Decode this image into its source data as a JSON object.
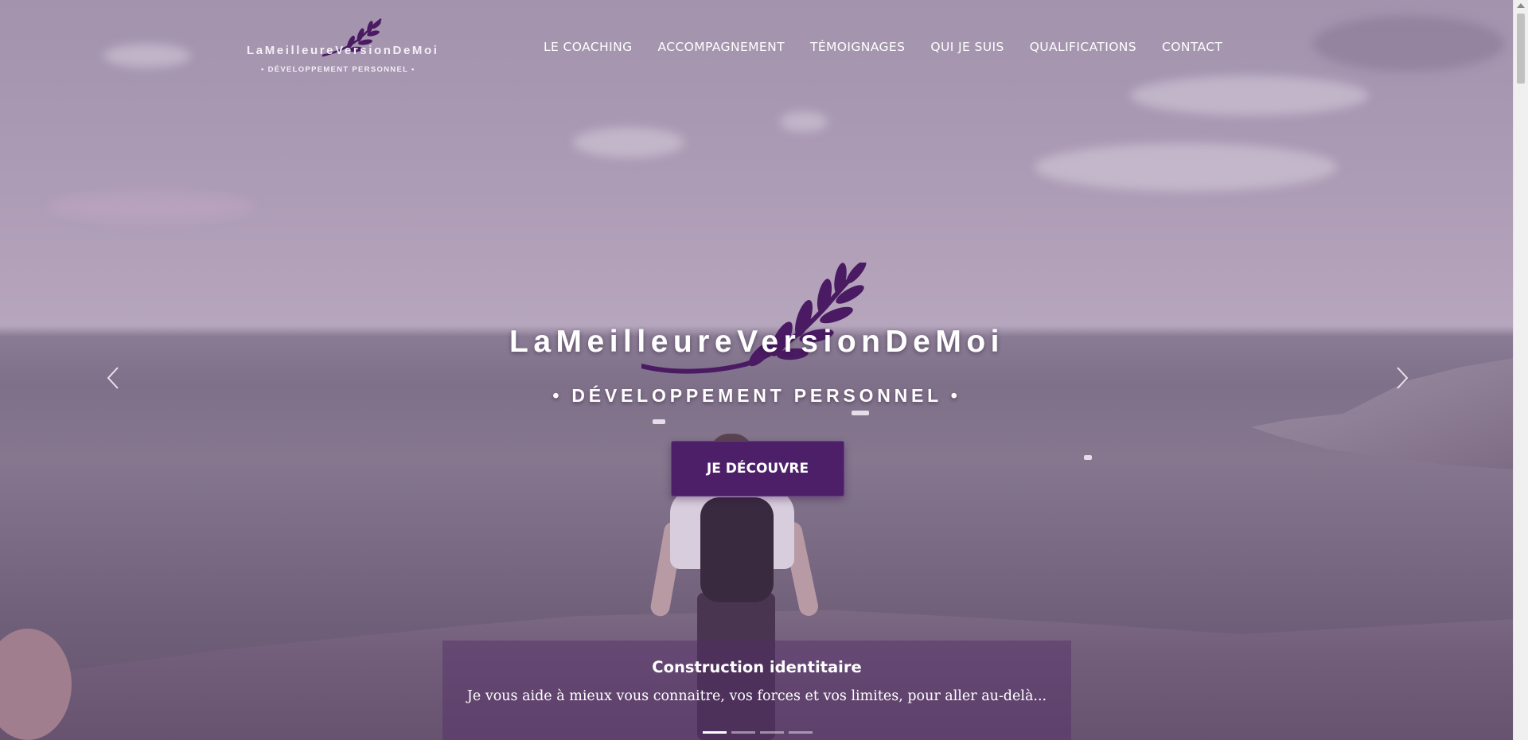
{
  "brand": {
    "name": "LaMeilleureVersionDeMoi",
    "tagline": "• DÉVELOPPEMENT PERSONNEL •"
  },
  "nav": {
    "items": [
      {
        "label": "LE COACHING"
      },
      {
        "label": "ACCOMPAGNEMENT"
      },
      {
        "label": "TÉMOIGNAGES"
      },
      {
        "label": "QUI JE SUIS"
      },
      {
        "label": "QUALIFICATIONS"
      },
      {
        "label": "CONTACT"
      }
    ]
  },
  "hero": {
    "title": "LaMeilleureVersionDeMoi",
    "subtitle": "• DÉVELOPPEMENT PERSONNEL •",
    "cta_label": "JE DÉCOUVRE",
    "prev_icon": "chevron-left-icon",
    "next_icon": "chevron-right-icon"
  },
  "carousel": {
    "caption_title": "Construction identitaire",
    "caption_text": "Je vous aide à mieux vous connaitre, vos forces et vos limites, pour aller au-delà...",
    "slide_count": 4,
    "active_index": 0
  },
  "colors": {
    "accent": "#4d1f68",
    "leaf": "#4a1a63",
    "overlay": "#a393ad"
  }
}
